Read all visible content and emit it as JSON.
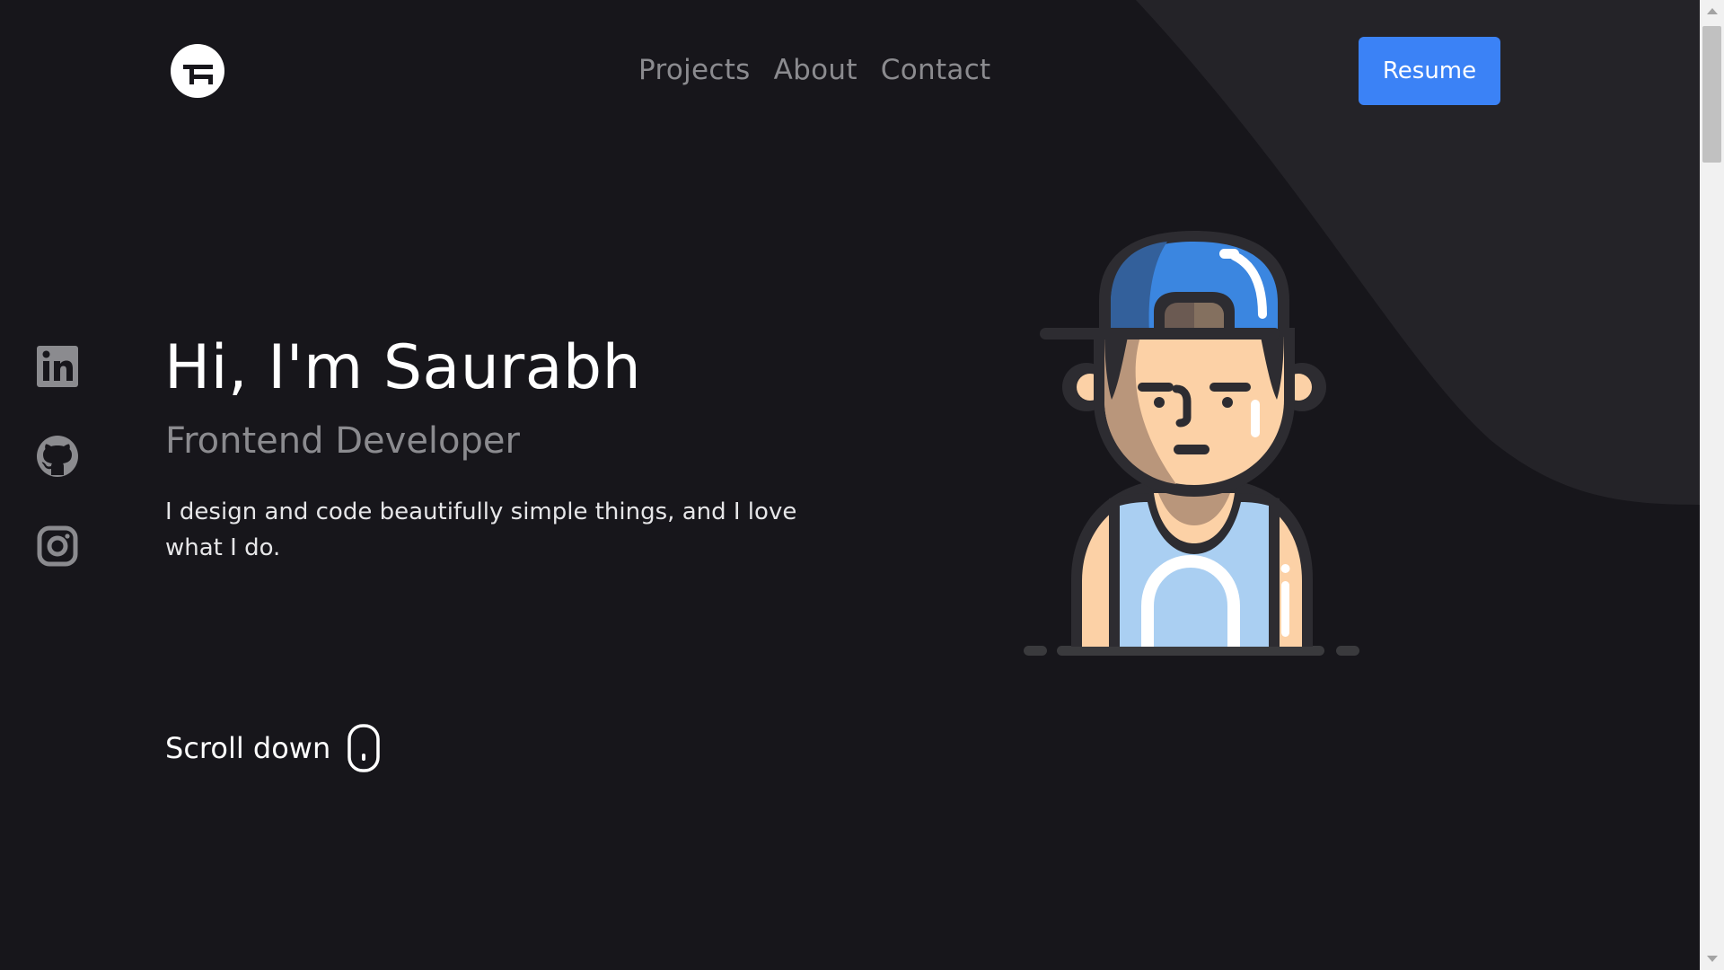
{
  "header": {
    "logo_icon": "g-logo-icon",
    "nav": [
      {
        "label": "Projects"
      },
      {
        "label": "About"
      },
      {
        "label": "Contact"
      }
    ],
    "resume_label": "Resume"
  },
  "socials": [
    {
      "icon": "linkedin-icon"
    },
    {
      "icon": "github-icon"
    },
    {
      "icon": "instagram-icon"
    }
  ],
  "hero": {
    "title": "Hi, I'm Saurabh",
    "subtitle": "Frontend Developer",
    "description": "I design and code beautifully simple things, and I love what I do."
  },
  "scroll": {
    "label": "Scroll down",
    "icon": "mouse-icon"
  },
  "illustration": {
    "icon": "avatar-illustration"
  },
  "colors": {
    "background": "#17161b",
    "shape": "#242328",
    "accent": "#3b82f6",
    "muted_text": "#8b8b8f"
  }
}
